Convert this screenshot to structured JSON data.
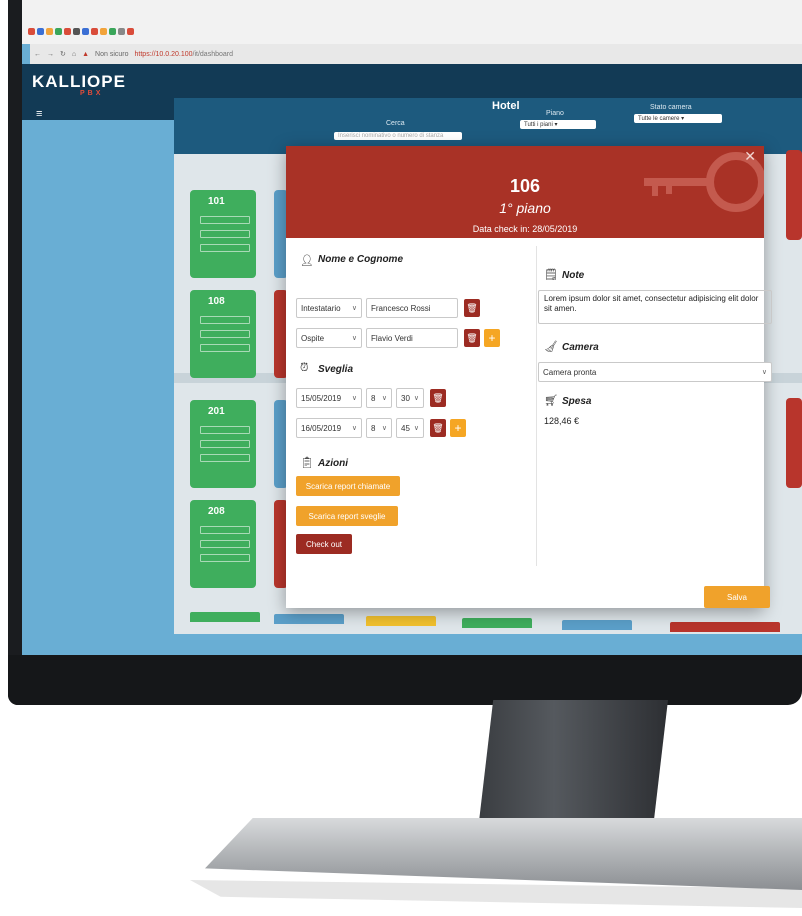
{
  "browser": {
    "security_label": "Non sicuro",
    "url_host": "https://10.0.20.100",
    "url_path": "/it/dashboard"
  },
  "app": {
    "logo_main": "KALLIOPE",
    "logo_sub": "PBX",
    "menu_icon": "hamburger-icon"
  },
  "hotel": {
    "title": "Hotel",
    "search_label": "Cerca",
    "search_placeholder": "Inserisci nominativo o numero di stanza",
    "floor_label": "Piano",
    "floor_value": "Tutti i piani",
    "room_status_label": "Stato camera",
    "room_status_value": "Tutte le camere"
  },
  "rooms": [
    {
      "number": "101",
      "color": "#3fae5d"
    },
    {
      "number": "108",
      "color": "#3fae5d"
    },
    {
      "number": "201",
      "color": "#3fae5d"
    },
    {
      "number": "208",
      "color": "#3fae5d"
    }
  ],
  "modal": {
    "room": "106",
    "floor": "1° piano",
    "checkin": "Data check in: 28/05/2019",
    "close_icon": "close-icon",
    "name_section": {
      "title": "Nome e Cognome",
      "rows": [
        {
          "role": "Intestatario",
          "name": "Francesco Rossi"
        },
        {
          "role": "Ospite",
          "name": "Flavio Verdi"
        }
      ]
    },
    "wakeup_section": {
      "title": "Sveglia",
      "rows": [
        {
          "date": "15/05/2019",
          "hour": "8",
          "minute": "30"
        },
        {
          "date": "16/05/2019",
          "hour": "8",
          "minute": "45"
        }
      ]
    },
    "actions_section": {
      "title": "Azioni",
      "download_calls": "Scarica report chiamate",
      "download_wakeups": "Scarica report sveglie",
      "checkout": "Check out"
    },
    "notes_section": {
      "title": "Note",
      "text": "Lorem ipsum dolor sit amet, consectetur adipisicing elit dolor sit amen."
    },
    "room_section": {
      "title": "Camera",
      "status": "Camera pronta"
    },
    "expense_section": {
      "title": "Spesa",
      "amount": "128,46 €"
    },
    "save": "Salva"
  },
  "colors": {
    "header_red": "#a93226",
    "accent_orange": "#f0a22b",
    "dark_red": "#9c2b22",
    "room_green": "#3fae5d",
    "app_navy": "#123a55"
  }
}
